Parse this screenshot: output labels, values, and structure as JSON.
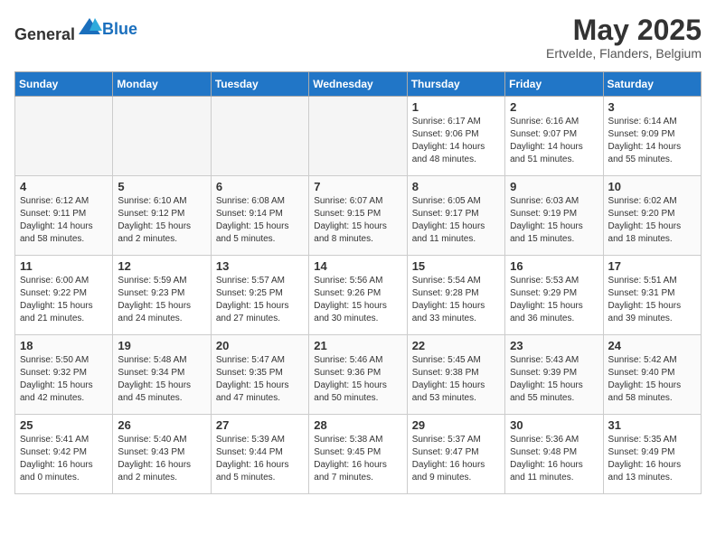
{
  "header": {
    "logo_general": "General",
    "logo_blue": "Blue",
    "month_year": "May 2025",
    "location": "Ertvelde, Flanders, Belgium"
  },
  "weekdays": [
    "Sunday",
    "Monday",
    "Tuesday",
    "Wednesday",
    "Thursday",
    "Friday",
    "Saturday"
  ],
  "weeks": [
    [
      {
        "day": "",
        "info": ""
      },
      {
        "day": "",
        "info": ""
      },
      {
        "day": "",
        "info": ""
      },
      {
        "day": "",
        "info": ""
      },
      {
        "day": "1",
        "info": "Sunrise: 6:17 AM\nSunset: 9:06 PM\nDaylight: 14 hours\nand 48 minutes."
      },
      {
        "day": "2",
        "info": "Sunrise: 6:16 AM\nSunset: 9:07 PM\nDaylight: 14 hours\nand 51 minutes."
      },
      {
        "day": "3",
        "info": "Sunrise: 6:14 AM\nSunset: 9:09 PM\nDaylight: 14 hours\nand 55 minutes."
      }
    ],
    [
      {
        "day": "4",
        "info": "Sunrise: 6:12 AM\nSunset: 9:11 PM\nDaylight: 14 hours\nand 58 minutes."
      },
      {
        "day": "5",
        "info": "Sunrise: 6:10 AM\nSunset: 9:12 PM\nDaylight: 15 hours\nand 2 minutes."
      },
      {
        "day": "6",
        "info": "Sunrise: 6:08 AM\nSunset: 9:14 PM\nDaylight: 15 hours\nand 5 minutes."
      },
      {
        "day": "7",
        "info": "Sunrise: 6:07 AM\nSunset: 9:15 PM\nDaylight: 15 hours\nand 8 minutes."
      },
      {
        "day": "8",
        "info": "Sunrise: 6:05 AM\nSunset: 9:17 PM\nDaylight: 15 hours\nand 11 minutes."
      },
      {
        "day": "9",
        "info": "Sunrise: 6:03 AM\nSunset: 9:19 PM\nDaylight: 15 hours\nand 15 minutes."
      },
      {
        "day": "10",
        "info": "Sunrise: 6:02 AM\nSunset: 9:20 PM\nDaylight: 15 hours\nand 18 minutes."
      }
    ],
    [
      {
        "day": "11",
        "info": "Sunrise: 6:00 AM\nSunset: 9:22 PM\nDaylight: 15 hours\nand 21 minutes."
      },
      {
        "day": "12",
        "info": "Sunrise: 5:59 AM\nSunset: 9:23 PM\nDaylight: 15 hours\nand 24 minutes."
      },
      {
        "day": "13",
        "info": "Sunrise: 5:57 AM\nSunset: 9:25 PM\nDaylight: 15 hours\nand 27 minutes."
      },
      {
        "day": "14",
        "info": "Sunrise: 5:56 AM\nSunset: 9:26 PM\nDaylight: 15 hours\nand 30 minutes."
      },
      {
        "day": "15",
        "info": "Sunrise: 5:54 AM\nSunset: 9:28 PM\nDaylight: 15 hours\nand 33 minutes."
      },
      {
        "day": "16",
        "info": "Sunrise: 5:53 AM\nSunset: 9:29 PM\nDaylight: 15 hours\nand 36 minutes."
      },
      {
        "day": "17",
        "info": "Sunrise: 5:51 AM\nSunset: 9:31 PM\nDaylight: 15 hours\nand 39 minutes."
      }
    ],
    [
      {
        "day": "18",
        "info": "Sunrise: 5:50 AM\nSunset: 9:32 PM\nDaylight: 15 hours\nand 42 minutes."
      },
      {
        "day": "19",
        "info": "Sunrise: 5:48 AM\nSunset: 9:34 PM\nDaylight: 15 hours\nand 45 minutes."
      },
      {
        "day": "20",
        "info": "Sunrise: 5:47 AM\nSunset: 9:35 PM\nDaylight: 15 hours\nand 47 minutes."
      },
      {
        "day": "21",
        "info": "Sunrise: 5:46 AM\nSunset: 9:36 PM\nDaylight: 15 hours\nand 50 minutes."
      },
      {
        "day": "22",
        "info": "Sunrise: 5:45 AM\nSunset: 9:38 PM\nDaylight: 15 hours\nand 53 minutes."
      },
      {
        "day": "23",
        "info": "Sunrise: 5:43 AM\nSunset: 9:39 PM\nDaylight: 15 hours\nand 55 minutes."
      },
      {
        "day": "24",
        "info": "Sunrise: 5:42 AM\nSunset: 9:40 PM\nDaylight: 15 hours\nand 58 minutes."
      }
    ],
    [
      {
        "day": "25",
        "info": "Sunrise: 5:41 AM\nSunset: 9:42 PM\nDaylight: 16 hours\nand 0 minutes."
      },
      {
        "day": "26",
        "info": "Sunrise: 5:40 AM\nSunset: 9:43 PM\nDaylight: 16 hours\nand 2 minutes."
      },
      {
        "day": "27",
        "info": "Sunrise: 5:39 AM\nSunset: 9:44 PM\nDaylight: 16 hours\nand 5 minutes."
      },
      {
        "day": "28",
        "info": "Sunrise: 5:38 AM\nSunset: 9:45 PM\nDaylight: 16 hours\nand 7 minutes."
      },
      {
        "day": "29",
        "info": "Sunrise: 5:37 AM\nSunset: 9:47 PM\nDaylight: 16 hours\nand 9 minutes."
      },
      {
        "day": "30",
        "info": "Sunrise: 5:36 AM\nSunset: 9:48 PM\nDaylight: 16 hours\nand 11 minutes."
      },
      {
        "day": "31",
        "info": "Sunrise: 5:35 AM\nSunset: 9:49 PM\nDaylight: 16 hours\nand 13 minutes."
      }
    ]
  ]
}
